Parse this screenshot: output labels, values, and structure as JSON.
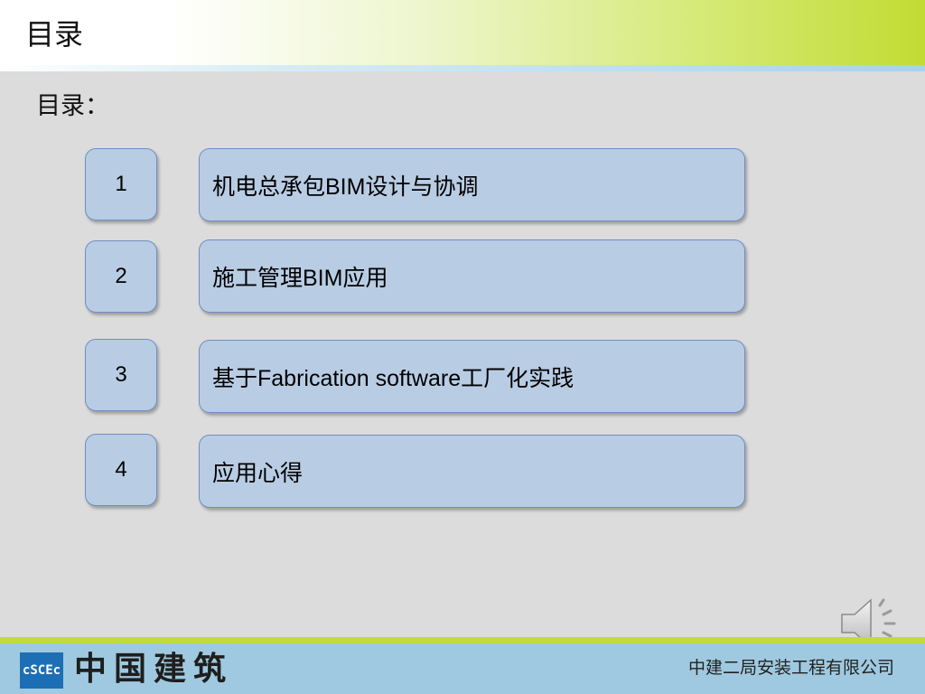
{
  "header": {
    "title": "目录"
  },
  "subtitle": "目录：",
  "items": [
    {
      "number": "1",
      "label": "机电总承包BIM设计与协调"
    },
    {
      "number": "2",
      "label": "施工管理BIM应用"
    },
    {
      "number": "3",
      "label": "基于Fabrication software工厂化实践"
    },
    {
      "number": "4",
      "label": "应用心得"
    }
  ],
  "footer": {
    "logo_mark": "cSCEc",
    "logo_text": "中国建筑",
    "company": "中建二局安装工程有限公司"
  },
  "icons": {
    "audio": "speaker-icon"
  },
  "colors": {
    "box_fill": "#b8cce4",
    "box_border": "#6f8fc0",
    "accent_green": "#c3db3a",
    "footer_blue": "#9fc9e0"
  }
}
